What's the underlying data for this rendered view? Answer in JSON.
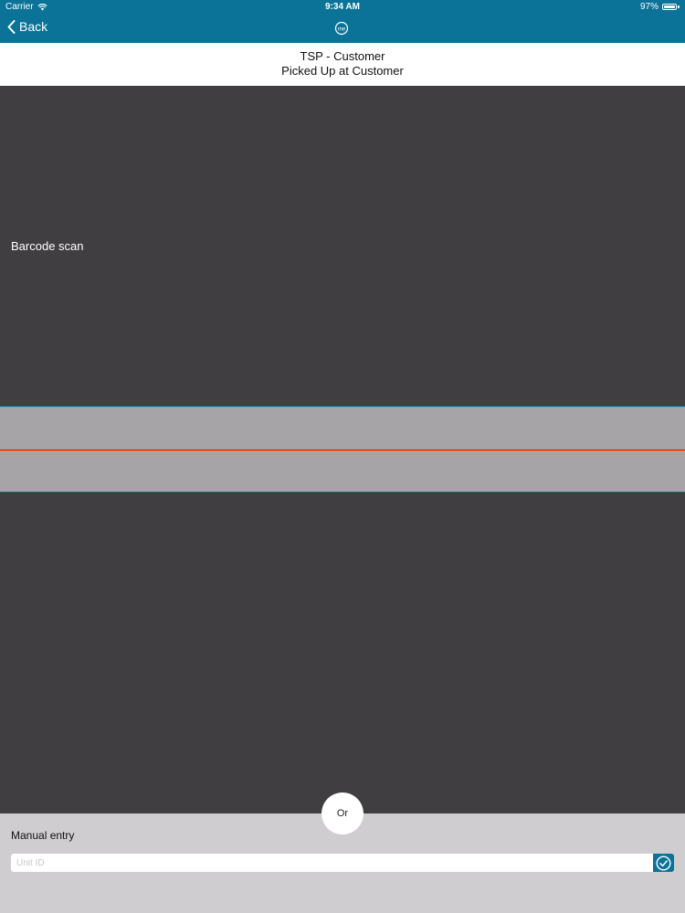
{
  "status_bar": {
    "carrier": "Carrier",
    "time": "9:34 AM",
    "battery_percent": "97%",
    "battery_level": 0.97
  },
  "nav": {
    "back_label": "Back",
    "logo_icon": "me-logo-icon"
  },
  "header": {
    "title": "TSP - Customer",
    "subtitle": "Picked Up at Customer"
  },
  "scanner": {
    "label": "Barcode scan"
  },
  "divider": {
    "label": "Or"
  },
  "manual_entry": {
    "label": "Manual entry",
    "placeholder": "Unit ID",
    "value": "",
    "confirm_icon": "check-circle-icon"
  },
  "colors": {
    "accent": "#0a7397",
    "scanner_bg": "#403e41",
    "scan_line": "#e8491d",
    "scan_border": "#2aa3c4"
  }
}
